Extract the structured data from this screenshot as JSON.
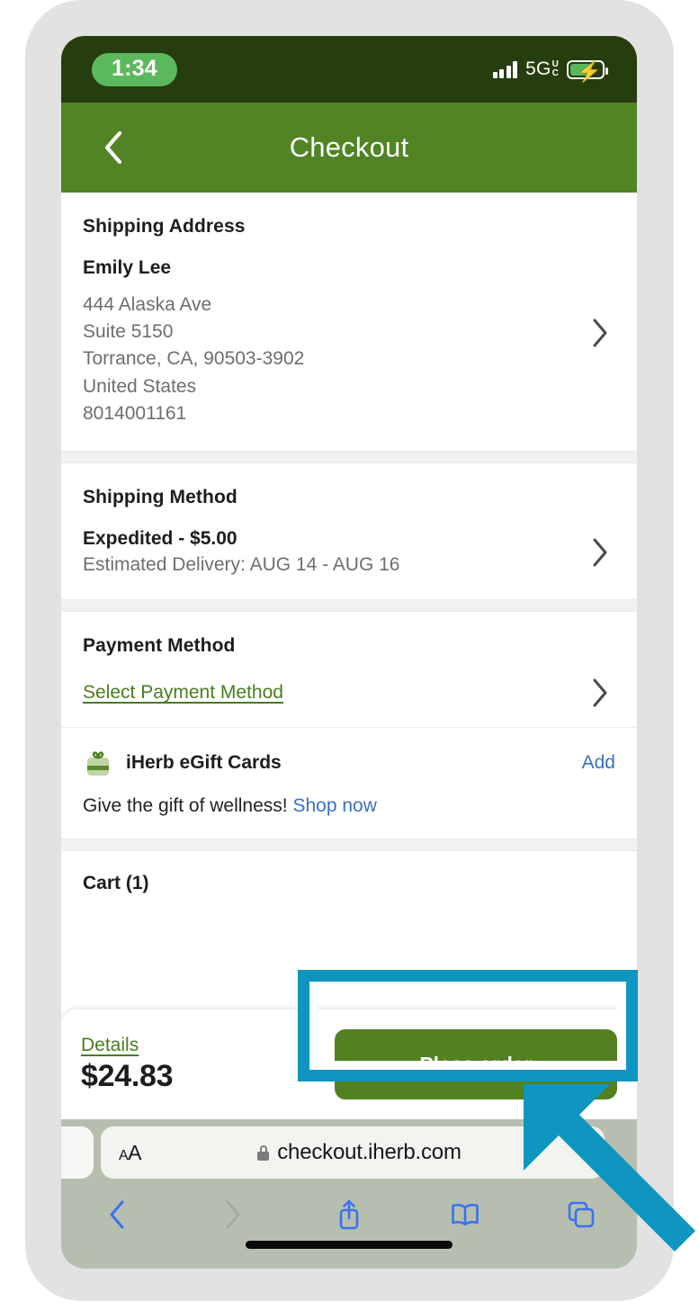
{
  "status_bar": {
    "time": "1:34",
    "network_label": "5G",
    "network_sup": "U",
    "network_sub": "C",
    "signal_icon": "cellular-signal-icon",
    "battery_icon": "battery-charging-icon"
  },
  "header": {
    "title": "Checkout",
    "back_icon": "chevron-left-icon"
  },
  "shipping_address": {
    "section_title": "Shipping Address",
    "recipient": "Emily Lee",
    "lines": [
      "444 Alaska Ave",
      "Suite 5150",
      "Torrance, CA, 90503-3902",
      "United States",
      "8014001161"
    ],
    "chevron_icon": "chevron-right-icon"
  },
  "shipping_method": {
    "section_title": "Shipping Method",
    "option": "Expedited - $5.00",
    "eta": "Estimated Delivery: AUG 14 - AUG 16",
    "chevron_icon": "chevron-right-icon"
  },
  "payment_method": {
    "section_title": "Payment Method",
    "select_link": "Select Payment Method",
    "chevron_icon": "chevron-right-icon"
  },
  "gift_cards": {
    "icon": "gift-box-icon",
    "label": "iHerb eGift Cards",
    "add_label": "Add",
    "promo_text": "Give the gift of wellness!",
    "promo_link": "Shop now"
  },
  "cart": {
    "title": "Cart (1)"
  },
  "order_bar": {
    "details_label": "Details",
    "total": "$24.83",
    "place_order_label": "Place order"
  },
  "safari": {
    "text_size_label": "A",
    "text_size_label_small": "A",
    "lock_icon": "lock-icon",
    "url": "checkout.iherb.com",
    "back_icon": "chevron-left-icon",
    "forward_icon": "chevron-right-icon",
    "share_icon": "share-icon",
    "bookmarks_icon": "book-icon",
    "tabs_icon": "tabs-icon"
  },
  "colors": {
    "header_green": "#508425",
    "status_bar_green": "#263d0f",
    "button_green": "#538021",
    "link_green": "#4a7c1f",
    "link_blue": "#3a6fc4",
    "highlight_cyan": "#0e96c0",
    "device_frame": "#e2e2e2",
    "safari_chrome": "#b6bfaf"
  }
}
